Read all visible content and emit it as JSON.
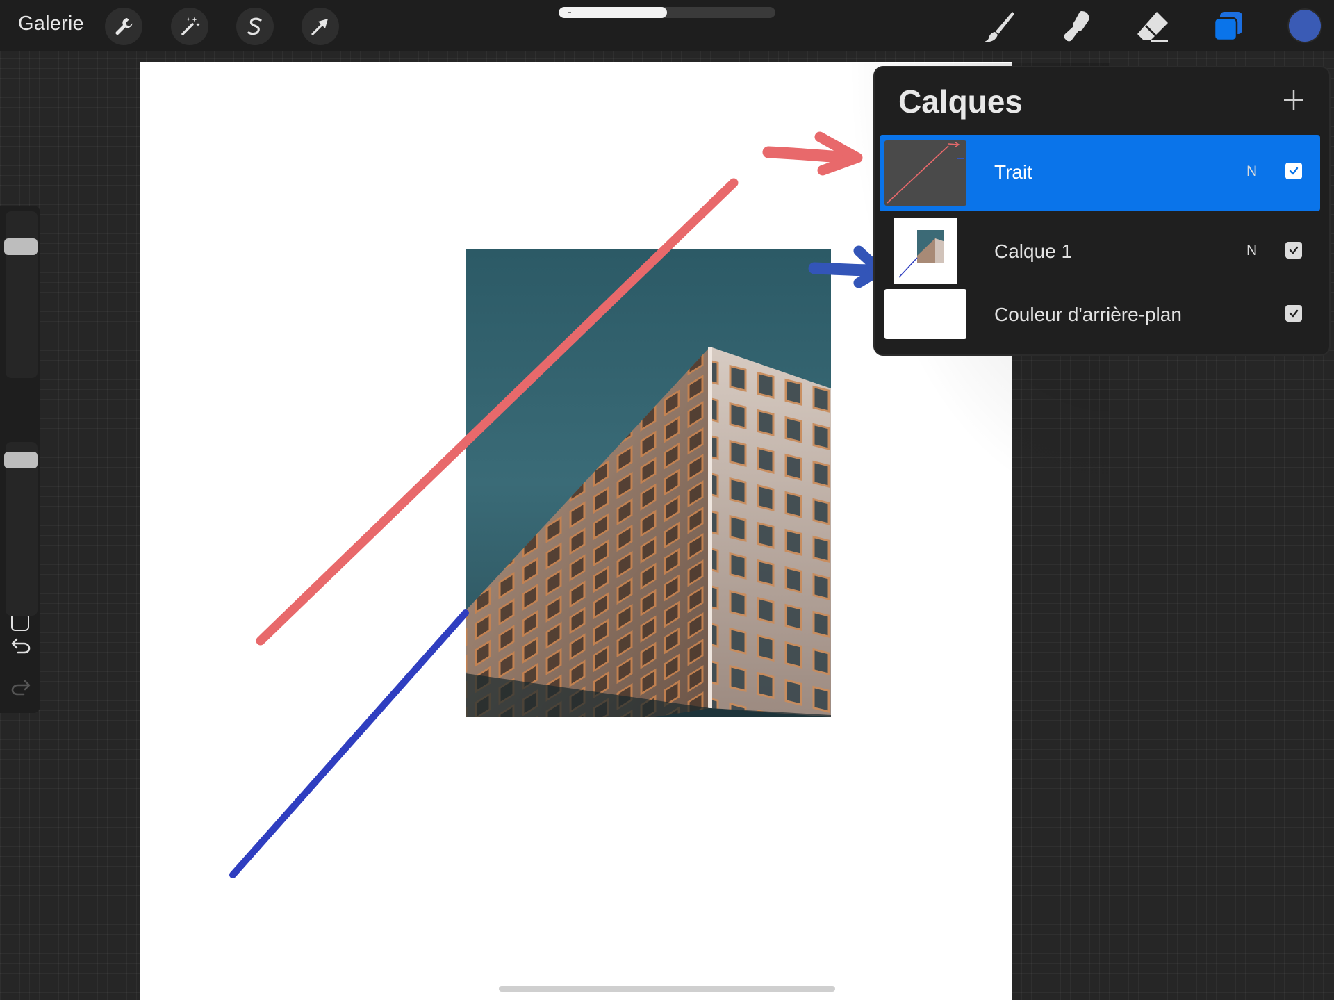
{
  "topbar": {
    "gallery_label": "Galerie",
    "left_tools": [
      {
        "name": "actions",
        "icon": "wrench-icon"
      },
      {
        "name": "adjustments",
        "icon": "magic-wand-icon"
      },
      {
        "name": "selection",
        "icon": "selection-s-icon"
      },
      {
        "name": "transform",
        "icon": "transform-arrow-icon"
      }
    ],
    "progress": 0.5,
    "right_tools": [
      {
        "name": "brush",
        "icon": "brush-icon"
      },
      {
        "name": "smudge",
        "icon": "smudge-finger-icon"
      },
      {
        "name": "eraser",
        "icon": "eraser-icon"
      },
      {
        "name": "layers",
        "icon": "layers-icon",
        "active": true
      }
    ],
    "active_color": "#3a5bb5"
  },
  "sidebar": {
    "brush_size": 0.82,
    "opacity": 0.94,
    "undo_icon": "undo-icon",
    "redo_icon": "redo-icon"
  },
  "canvas": {
    "stroke_colors": {
      "red": "#e8696b",
      "blue": "#2f3ec0"
    }
  },
  "layers_panel": {
    "title": "Calques",
    "add_icon": "plus-icon",
    "layers": [
      {
        "name": "Trait",
        "blend": "N",
        "visible": true,
        "selected": true
      },
      {
        "name": "Calque 1",
        "blend": "N",
        "visible": true,
        "selected": false
      },
      {
        "name": "Couleur d'arrière-plan",
        "blend": "",
        "visible": true,
        "selected": false
      }
    ]
  },
  "colors": {
    "accent": "#0a74ea",
    "panel": "#1f1f1f",
    "topbar": "#1e1e1e"
  }
}
